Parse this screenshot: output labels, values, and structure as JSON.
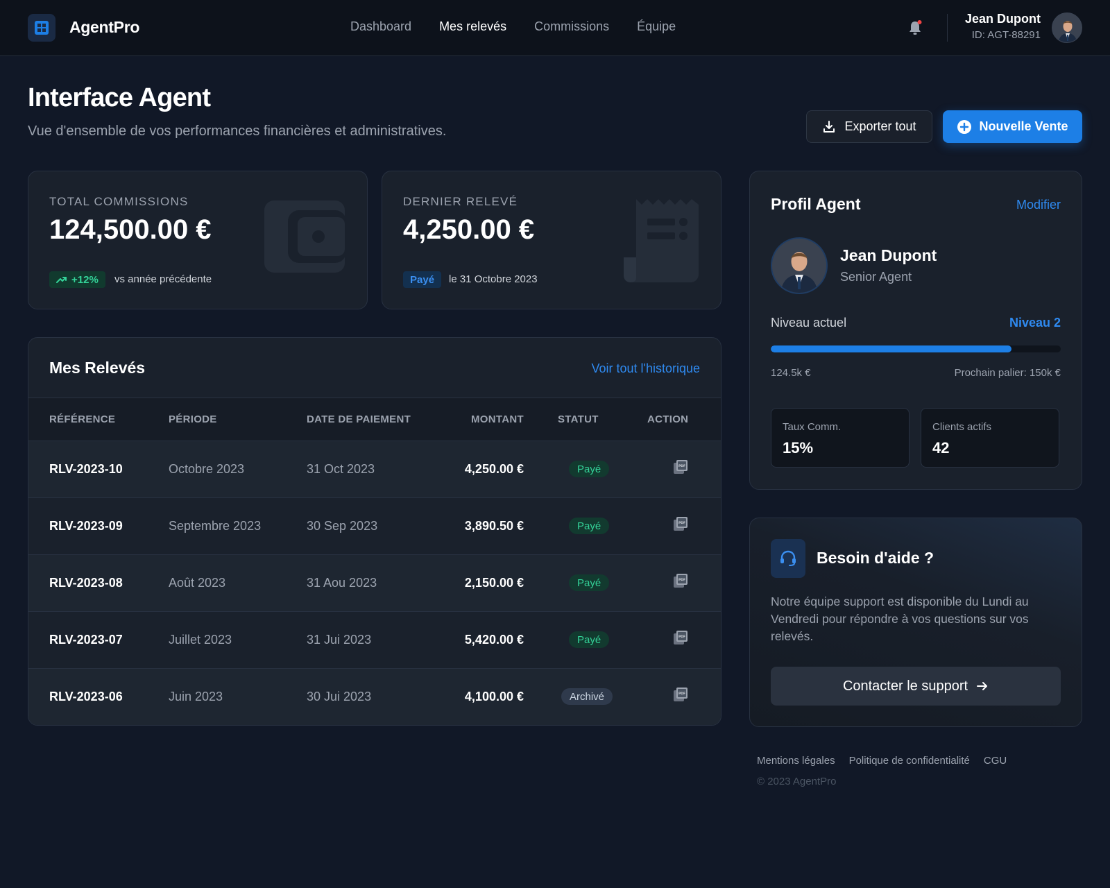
{
  "app": {
    "name": "AgentPro"
  },
  "nav": {
    "items": [
      {
        "label": "Dashboard"
      },
      {
        "label": "Mes relevés"
      },
      {
        "label": "Commissions"
      },
      {
        "label": "Équipe"
      }
    ],
    "active_index": 1
  },
  "user": {
    "name": "Jean Dupont",
    "id_text": "ID: AGT-88291"
  },
  "header": {
    "title": "Interface Agent",
    "subtitle": "Vue d'ensemble de vos performances financières et administratives.",
    "export_label": "Exporter tout",
    "new_sale_label": "Nouvelle Vente"
  },
  "stats": {
    "commissions": {
      "label": "TOTAL COMMISSIONS",
      "value": "124,500.00 €",
      "trend": "+12%",
      "trend_text": "vs année précédente"
    },
    "last_statement": {
      "label": "DERNIER RELEVÉ",
      "value": "4,250.00 €",
      "status": "Payé",
      "date_text": "le 31 Octobre 2023"
    }
  },
  "statements": {
    "title": "Mes Relevés",
    "history_link": "Voir tout l'historique",
    "columns": {
      "ref": "RÉFÉRENCE",
      "period": "PÉRIODE",
      "date": "DATE DE PAIEMENT",
      "amount": "MONTANT",
      "status": "STATUT",
      "action": "ACTION"
    },
    "rows": [
      {
        "ref": "RLV-2023-10",
        "period": "Octobre 2023",
        "date": "31 Oct 2023",
        "amount": "4,250.00 €",
        "status": "Payé"
      },
      {
        "ref": "RLV-2023-09",
        "period": "Septembre 2023",
        "date": "30 Sep 2023",
        "amount": "3,890.50 €",
        "status": "Payé"
      },
      {
        "ref": "RLV-2023-08",
        "period": "Août 2023",
        "date": "31 Aou 2023",
        "amount": "2,150.00 €",
        "status": "Payé"
      },
      {
        "ref": "RLV-2023-07",
        "period": "Juillet 2023",
        "date": "31 Jui 2023",
        "amount": "5,420.00 €",
        "status": "Payé"
      },
      {
        "ref": "RLV-2023-06",
        "period": "Juin 2023",
        "date": "30 Jui 2023",
        "amount": "4,100.00 €",
        "status": "Archivé"
      }
    ]
  },
  "profile": {
    "title": "Profil Agent",
    "edit_label": "Modifier",
    "name": "Jean Dupont",
    "role": "Senior Agent",
    "level_label": "Niveau actuel",
    "level_value": "Niveau 2",
    "progress_fraction": 0.83,
    "progress_current": "124.5k €",
    "progress_next": "Prochain palier: 150k €",
    "commission_rate_label": "Taux Comm.",
    "commission_rate_value": "15%",
    "active_clients_label": "Clients actifs",
    "active_clients_value": "42"
  },
  "help": {
    "title": "Besoin d'aide ?",
    "text": "Notre équipe support est disponible du Lundi au Vendredi pour répondre à vos questions sur vos relevés.",
    "button_label": "Contacter le support"
  },
  "footer": {
    "links": [
      {
        "label": "Mentions légales"
      },
      {
        "label": "Politique de confidentialité"
      },
      {
        "label": "CGU"
      }
    ],
    "copyright": "© 2023 AgentPro"
  },
  "colors": {
    "accent": "#1d7fe6",
    "background": "#111827",
    "card": "#1a212c",
    "success": "#34d399"
  },
  "icons": {
    "logo": "grid-icon",
    "notification": "bell-icon",
    "export": "download-icon",
    "new_sale": "plus-circle-icon",
    "wallet": "wallet-icon",
    "receipt": "receipt-icon",
    "trend": "trending-up-icon",
    "pdf": "pdf-icon",
    "support": "headset-icon",
    "arrow": "arrow-right-icon"
  }
}
